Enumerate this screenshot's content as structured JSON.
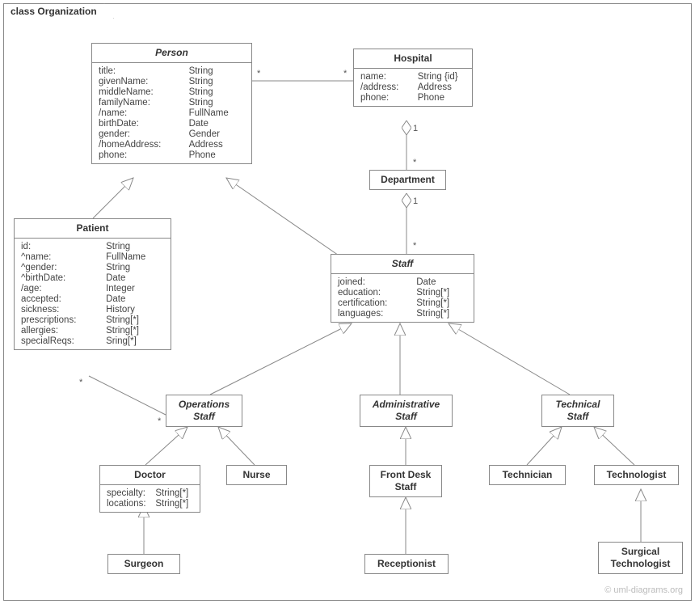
{
  "frame": {
    "title": "class Organization"
  },
  "classes": {
    "person": {
      "name": "Person",
      "attrs": [
        [
          "title:",
          "String"
        ],
        [
          "givenName:",
          "String"
        ],
        [
          "middleName:",
          "String"
        ],
        [
          "familyName:",
          "String"
        ],
        [
          "/name:",
          "FullName"
        ],
        [
          "birthDate:",
          "Date"
        ],
        [
          "gender:",
          "Gender"
        ],
        [
          "/homeAddress:",
          "Address"
        ],
        [
          "phone:",
          "Phone"
        ]
      ]
    },
    "hospital": {
      "name": "Hospital",
      "attrs": [
        [
          "name:",
          "String {id}"
        ],
        [
          "/address:",
          "Address"
        ],
        [
          "phone:",
          "Phone"
        ]
      ]
    },
    "department": {
      "name": "Department"
    },
    "patient": {
      "name": "Patient",
      "attrs": [
        [
          "id:",
          "String"
        ],
        [
          "^name:",
          "FullName"
        ],
        [
          "^gender:",
          "String"
        ],
        [
          "^birthDate:",
          "Date"
        ],
        [
          "/age:",
          "Integer"
        ],
        [
          "accepted:",
          "Date"
        ],
        [
          "sickness:",
          "History"
        ],
        [
          "prescriptions:",
          "String[*]"
        ],
        [
          "allergies:",
          "String[*]"
        ],
        [
          "specialReqs:",
          "Sring[*]"
        ]
      ]
    },
    "staff": {
      "name": "Staff",
      "attrs": [
        [
          "joined:",
          "Date"
        ],
        [
          "education:",
          "String[*]"
        ],
        [
          "certification:",
          "String[*]"
        ],
        [
          "languages:",
          "String[*]"
        ]
      ]
    },
    "opsStaff": {
      "name": "Operations\nStaff"
    },
    "adminStaff": {
      "name": "Administrative\nStaff"
    },
    "techStaff": {
      "name": "Technical\nStaff"
    },
    "doctor": {
      "name": "Doctor",
      "attrs": [
        [
          "specialty:",
          "String[*]"
        ],
        [
          "locations:",
          "String[*]"
        ]
      ]
    },
    "nurse": {
      "name": "Nurse"
    },
    "frontDesk": {
      "name": "Front Desk\nStaff"
    },
    "technician": {
      "name": "Technician"
    },
    "technologist": {
      "name": "Technologist"
    },
    "surgeon": {
      "name": "Surgeon"
    },
    "receptionist": {
      "name": "Receptionist"
    },
    "surgTech": {
      "name": "Surgical\nTechnologist"
    }
  },
  "multiplicities": {
    "person_hospital_left": "*",
    "person_hospital_right": "*",
    "hospital_dept_top": "1",
    "hospital_dept_bottom": "*",
    "dept_staff_top": "1",
    "dept_staff_bottom": "*",
    "patient_ops_top": "*",
    "patient_ops_bottom": "*"
  },
  "watermark": "© uml-diagrams.org"
}
